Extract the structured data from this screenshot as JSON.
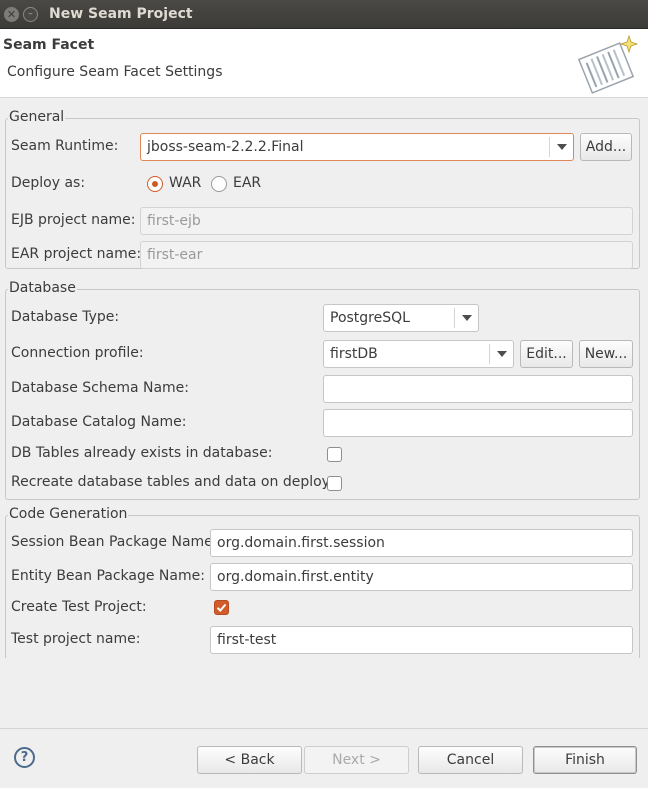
{
  "window": {
    "title": "New Seam Project"
  },
  "header": {
    "title": "Seam Facet",
    "subtitle": "Configure Seam Facet Settings",
    "icon": "seam-wizard-icon"
  },
  "general": {
    "group_label": "General",
    "seam_runtime_label": "Seam Runtime:",
    "seam_runtime_value": "jboss-seam-2.2.2.Final",
    "add_button": "Add...",
    "deploy_as_label": "Deploy as:",
    "deploy_war": "WAR",
    "deploy_ear": "EAR",
    "deploy_selected": "WAR",
    "ejb_label": "EJB project name:",
    "ejb_value": "first-ejb",
    "ear_label": "EAR project name:",
    "ear_value": "first-ear"
  },
  "database": {
    "group_label": "Database",
    "type_label": "Database Type:",
    "type_value": "PostgreSQL",
    "profile_label": "Connection profile:",
    "profile_value": "firstDB",
    "edit_button": "Edit...",
    "new_button": "New...",
    "schema_label": "Database Schema Name:",
    "schema_value": "",
    "catalog_label": "Database Catalog Name:",
    "catalog_value": "",
    "tables_exist_label": "DB Tables already exists in database:",
    "tables_exist_checked": false,
    "recreate_label": "Recreate database tables and data on deploy:",
    "recreate_checked": false
  },
  "codegen": {
    "group_label": "Code Generation",
    "session_label": "Session Bean Package Name:",
    "session_value": "org.domain.first.session",
    "entity_label": "Entity Bean Package Name:",
    "entity_value": "org.domain.first.entity",
    "create_test_label": "Create Test Project:",
    "create_test_checked": true,
    "test_name_label": "Test project name:",
    "test_name_value": "first-test"
  },
  "footer": {
    "help_icon": "help-icon",
    "back_button": "< Back",
    "next_button": "Next >",
    "cancel_button": "Cancel",
    "finish_button": "Finish"
  },
  "colors": {
    "accent": "#d05a24",
    "titlebar": "#3c3b37",
    "background": "#efefef"
  }
}
